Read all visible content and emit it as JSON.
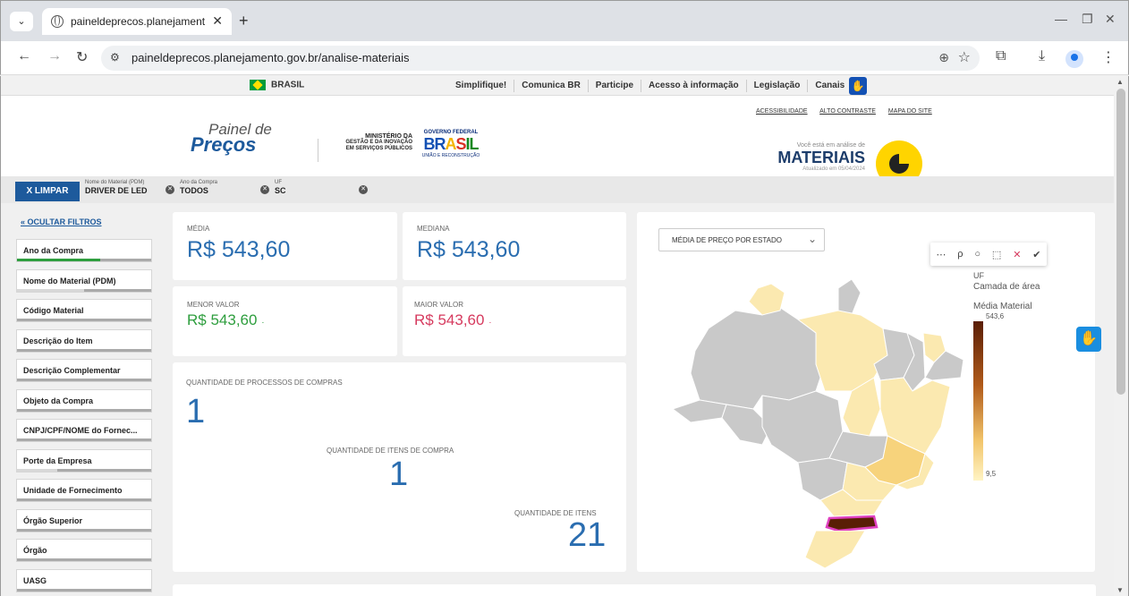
{
  "browser": {
    "tab_title": "paineldeprecos.planejamento.g",
    "url": "paineldeprecos.planejamento.gov.br/analise-materiais"
  },
  "govbar": {
    "brasil": "BRASIL",
    "links": [
      "Simplifique!",
      "Comunica BR",
      "Participe",
      "Acesso à informação",
      "Legislação",
      "Canais"
    ]
  },
  "header": {
    "logo_line1": "Painel de",
    "logo_line2": "Preços",
    "ministerio": [
      "MINISTÉRIO DA",
      "GESTÃO E DA INOVAÇÃO",
      "EM SERVIÇOS PÚBLICOS"
    ],
    "gov_federal": "GOVERNO FEDERAL",
    "gov_brasil": "BRASIL",
    "gov_slogan": "UNIÃO E RECONSTRUÇÃO",
    "links": [
      "ACESSIBILIDADE",
      "ALTO CONTRASTE",
      "MAPA DO SITE"
    ],
    "analise_prefix": "Você está em análise de",
    "analise_title": "MATERIAIS",
    "updated": "Atualizado em 05/04/2024"
  },
  "filters": {
    "clear_label": "X LIMPAR",
    "chips": [
      {
        "label": "Nome do Material (PDM)",
        "value": "DRIVER DE LED"
      },
      {
        "label": "Ano da Compra",
        "value": "TODOS"
      },
      {
        "label": "UF",
        "value": "SC"
      }
    ]
  },
  "sidebar": {
    "toggle_label": "OCULTAR FILTROS",
    "items": [
      {
        "label": "Ano da Compra",
        "fill_color": "#2e9e3e",
        "fill": 0.62
      },
      {
        "label": "Nome do Material (PDM)",
        "fill_color": "#d8d8d8",
        "fill": 0.5
      },
      {
        "label": "Código Material"
      },
      {
        "label": "Descrição do Item"
      },
      {
        "label": "Descrição Complementar"
      },
      {
        "label": "Objeto da Compra"
      },
      {
        "label": "CNPJ/CPF/NOME do Fornec..."
      },
      {
        "label": "Porte da Empresa",
        "fill_color": "#d8d8d8",
        "fill": 0.3
      },
      {
        "label": "Unidade de Fornecimento"
      },
      {
        "label": "Órgão Superior"
      },
      {
        "label": "Órgão"
      },
      {
        "label": "UASG"
      }
    ]
  },
  "kpis": {
    "media_label": "MÉDIA",
    "media_value": "R$ 543,60",
    "mediana_label": "MEDIANA",
    "mediana_value": "R$ 543,60",
    "menor_label": "MENOR VALOR",
    "menor_value": "R$ 543,60",
    "maior_label": "MAIOR VALOR",
    "maior_value": "R$ 543,60",
    "menor_color": "#2e9e3e",
    "maior_color": "#d63a5e"
  },
  "counts": {
    "processos_label": "QUANTIDADE DE PROCESSOS DE COMPRAS",
    "processos_value": "1",
    "itens_compra_label": "QUANTIDADE DE ITENS DE COMPRA",
    "itens_compra_value": "1",
    "itens_label": "QUANTIDADE DE ITENS",
    "itens_value": "21"
  },
  "map": {
    "dropdown": "MÉDIA DE PREÇO POR ESTADO",
    "legend_uf": "UF",
    "legend_layer": "Camada de área",
    "legend_title": "Média Material",
    "legend_max": "543,6",
    "legend_min": "9,5"
  }
}
